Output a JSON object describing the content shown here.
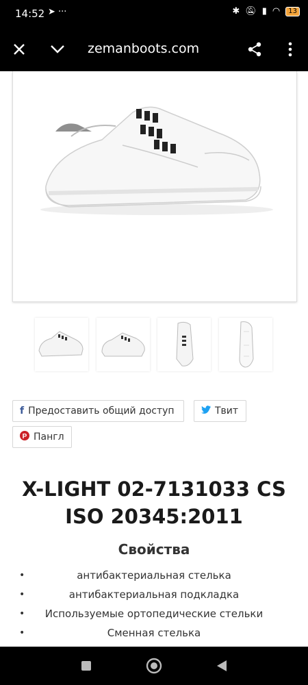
{
  "status_bar": {
    "time": "14:52",
    "battery": "13"
  },
  "browser": {
    "url": "zemanboots.com"
  },
  "share": {
    "facebook_label": "Предоставить общий доступ",
    "twitter_label": "Твит",
    "pinterest_label": "Пангл"
  },
  "product": {
    "title_line1": "X-LIGHT 02-7131033 CS",
    "title_line2": "ISO 20345:2011",
    "properties_heading": "Свойства",
    "properties": [
      "антибактериальная стелька",
      "антибактериальная подкладка",
      "Используемые ортопедические стельки",
      "Сменная стелька"
    ]
  },
  "colors": {
    "bars": "#000000",
    "twitter": "#1da1f2",
    "facebook": "#3b5998",
    "pinterest": "#cb2027",
    "battery": "#f2a33a"
  }
}
